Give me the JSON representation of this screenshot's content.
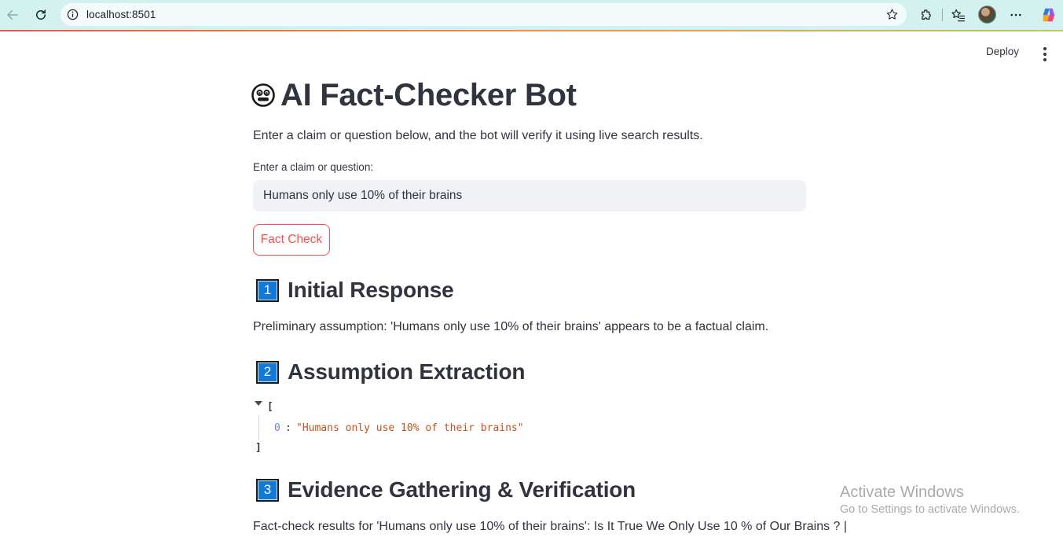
{
  "browser": {
    "url": "localhost:8501"
  },
  "header": {
    "deploy_label": "Deploy"
  },
  "main": {
    "title": "AI Fact-Checker Bot",
    "title_icon": "robot-face-icon",
    "intro": "Enter a claim or question below, and the bot will verify it using live search results.",
    "input_label": "Enter a claim or question:",
    "input_value": "Humans only use 10% of their brains",
    "button_label": "Fact Check",
    "accent_color": "#ff4b4b"
  },
  "sections": [
    {
      "number": "1",
      "title": "Initial Response",
      "text": "Preliminary assumption: 'Humans only use 10% of their brains' appears to be a factual claim."
    },
    {
      "number": "2",
      "title": "Assumption Extraction",
      "json": {
        "open": "[",
        "index": "0",
        "value": "\"Humans only use 10% of their brains\"",
        "close": "]"
      }
    },
    {
      "number": "3",
      "title": "Evidence Gathering & Verification",
      "text": "Fact-check results for 'Humans only use 10% of their brains': Is It True We Only Use 10 % of Our Brains ? |"
    }
  ],
  "watermark": {
    "title": "Activate Windows",
    "subtitle": "Go to Settings to activate Windows."
  }
}
